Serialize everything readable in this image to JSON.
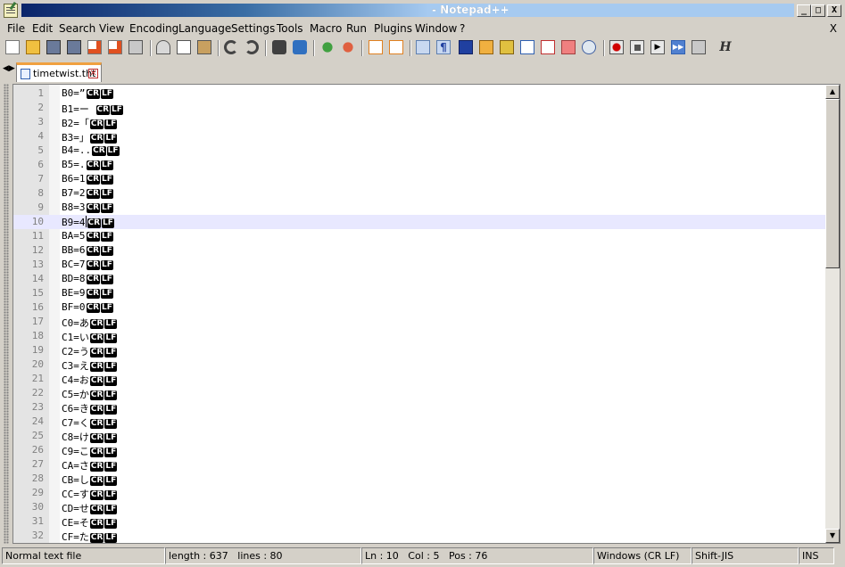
{
  "window": {
    "title": "- Notepad++",
    "controls": {
      "minimize": "_",
      "maximize": "□",
      "close": "X"
    }
  },
  "menu": {
    "items": [
      "File",
      "Edit",
      "Search",
      "View",
      "Encoding",
      "Language",
      "Settings",
      "Tools",
      "Macro",
      "Run",
      "Plugins",
      "Window",
      "?"
    ],
    "close_label": "X"
  },
  "toolbar": {
    "icons": [
      "new-file-icon",
      "open-file-icon",
      "save-icon",
      "save-all-icon",
      "close-icon",
      "close-all-icon",
      "print-icon",
      "cut-icon",
      "copy-icon",
      "paste-icon",
      "undo-icon",
      "redo-icon",
      "find-icon",
      "replace-icon",
      "zoom-in-icon",
      "zoom-out-icon",
      "sync-vertical-icon",
      "sync-horizontal-icon",
      "word-wrap-icon",
      "show-all-chars-icon",
      "indent-guide-icon",
      "user-lang-icon",
      "doc-map-icon",
      "function-list-icon",
      "folder-workspace-icon",
      "monitor-icon",
      "eye-icon",
      "record-macro-icon",
      "stop-macro-icon",
      "play-macro-icon",
      "run-macro-multiple-icon",
      "save-macro-icon",
      "hex-editor-icon"
    ]
  },
  "tabs": [
    {
      "label": "timetwist.tht",
      "active": true
    }
  ],
  "tab_nav": "◀▶",
  "editor": {
    "current_line": 10,
    "eol_tokens": [
      "CR",
      "LF"
    ],
    "lines": [
      {
        "n": "1",
        "text": "B0=”"
      },
      {
        "n": "2",
        "text": "B1=ー "
      },
      {
        "n": "3",
        "text": "B2=「"
      },
      {
        "n": "4",
        "text": "B3=」"
      },
      {
        "n": "5",
        "text": "B4=.."
      },
      {
        "n": "6",
        "text": "B5=."
      },
      {
        "n": "7",
        "text": "B6=1"
      },
      {
        "n": "8",
        "text": "B7=2"
      },
      {
        "n": "9",
        "text": "B8=3"
      },
      {
        "n": "10",
        "text": "B9=4"
      },
      {
        "n": "11",
        "text": "BA=5"
      },
      {
        "n": "12",
        "text": "BB=6"
      },
      {
        "n": "13",
        "text": "BC=7"
      },
      {
        "n": "14",
        "text": "BD=8"
      },
      {
        "n": "15",
        "text": "BE=9"
      },
      {
        "n": "16",
        "text": "BF=0"
      },
      {
        "n": "17",
        "text": "C0=あ"
      },
      {
        "n": "18",
        "text": "C1=い"
      },
      {
        "n": "19",
        "text": "C2=う"
      },
      {
        "n": "20",
        "text": "C3=え"
      },
      {
        "n": "21",
        "text": "C4=お"
      },
      {
        "n": "22",
        "text": "C5=か"
      },
      {
        "n": "23",
        "text": "C6=き"
      },
      {
        "n": "24",
        "text": "C7=く"
      },
      {
        "n": "25",
        "text": "C8=け"
      },
      {
        "n": "26",
        "text": "C9=こ"
      },
      {
        "n": "27",
        "text": "CA=さ"
      },
      {
        "n": "28",
        "text": "CB=し"
      },
      {
        "n": "29",
        "text": "CC=す"
      },
      {
        "n": "30",
        "text": "CD=せ"
      },
      {
        "n": "31",
        "text": "CE=そ"
      },
      {
        "n": "32",
        "text": "CF=た"
      }
    ]
  },
  "scrollbar": {
    "up": "▲",
    "down": "▼"
  },
  "status": {
    "file_type": "Normal text file",
    "length": "length : 637",
    "lines": "lines : 80",
    "ln": "Ln : 10",
    "col": "Col : 5",
    "pos": "Pos : 76",
    "eol_mode": "Windows (CR LF)",
    "encoding": "Shift-JIS",
    "insert_mode": "INS"
  }
}
